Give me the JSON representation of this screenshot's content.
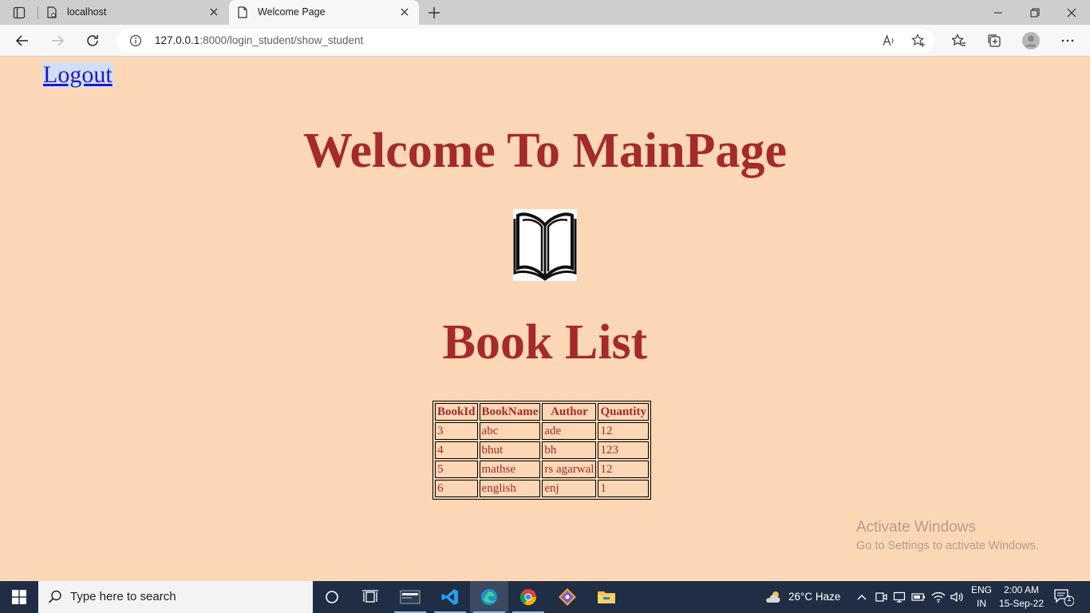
{
  "browser": {
    "tabs": [
      {
        "title": "localhost",
        "active": false
      },
      {
        "title": "Welcome Page",
        "active": true
      }
    ],
    "address": {
      "host": "127.0.0.1",
      "path": ":8000/login_student/show_student"
    }
  },
  "page": {
    "logout_label": "Logout",
    "main_title": "Welcome To MainPage",
    "section_title": "Book List",
    "table": {
      "headers": [
        "BookId",
        "BookName",
        "Author",
        "Quantity"
      ],
      "rows": [
        [
          "3",
          "abc",
          "ade",
          "12"
        ],
        [
          "4",
          "bhut",
          "bh",
          "123"
        ],
        [
          "5",
          "mathse",
          "rs agarwal",
          "12"
        ],
        [
          "6",
          "english",
          "enj",
          "1"
        ]
      ]
    },
    "colors": {
      "background": "#fcd7b6",
      "heading": "#a52a2a",
      "link": "#2a13c4"
    }
  },
  "watermark": {
    "line1": "Activate Windows",
    "line2": "Go to Settings to activate Windows."
  },
  "taskbar": {
    "search_placeholder": "Type here to search",
    "weather": "26°C  Haze",
    "lang_line1": "ENG",
    "lang_line2": "IN",
    "time": "2:00 AM",
    "date": "15-Sep-22",
    "notification_count": "1"
  }
}
